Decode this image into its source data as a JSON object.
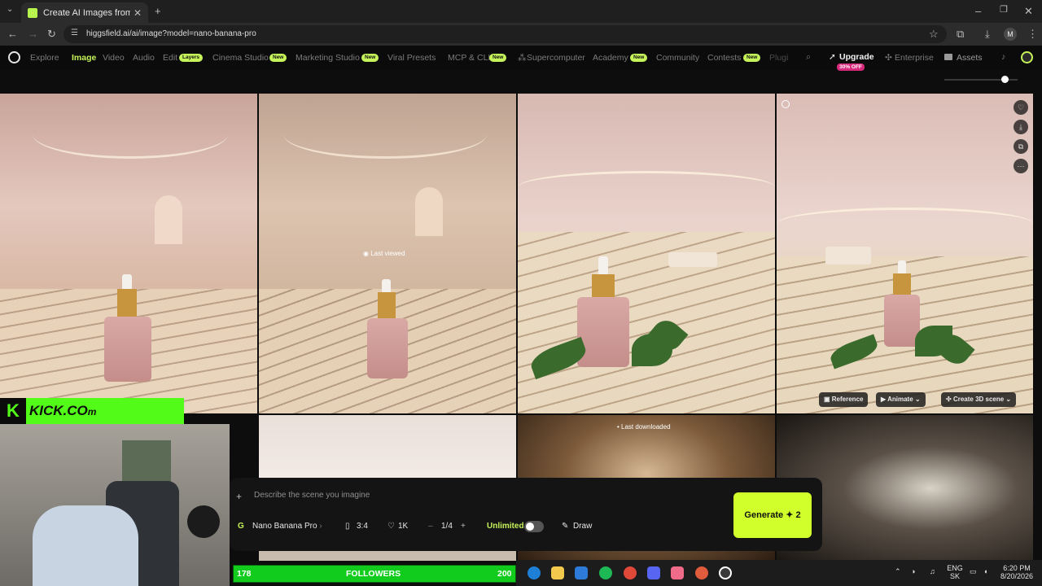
{
  "browser": {
    "tab_title": "Create AI Images from Text & P",
    "url": "higgsfield.ai/ai/image?model=nano-banana-pro",
    "profile_initial": "M"
  },
  "nav": {
    "items": [
      "Explore",
      "Image",
      "Video",
      "Audio",
      "Edit",
      "Cinema Studio",
      "Marketing Studio",
      "Viral Presets",
      "MCP & CLI",
      "Supercomputer",
      "Academy",
      "Community",
      "Contests",
      "Plugi"
    ],
    "active": "Image",
    "badges": {
      "edit": "Layers",
      "cinema": "New",
      "marketing": "New",
      "mcp": "New",
      "academy": "New",
      "contests": "New"
    },
    "upgrade": "Upgrade",
    "upgrade_badge": "30% OFF",
    "enterprise": "Enterprise",
    "assets": "Assets"
  },
  "gallery": {
    "last_viewed": "Last viewed",
    "last_downloaded": "Last downloaded",
    "actions": {
      "reference": "Reference",
      "animate": "Animate",
      "create_3d": "Create 3D scene"
    }
  },
  "prompt": {
    "placeholder": "Describe the scene you imagine",
    "model": "Nano Banana Pro",
    "aspect": "3:4",
    "resolution": "1K",
    "count": "1/4",
    "unlimited": "Unlimited",
    "draw": "Draw",
    "generate": "Generate",
    "generate_cost": "✦ 2"
  },
  "stream": {
    "kick_text": "KICK.CO",
    "followers_count": "178",
    "followers_label": "FOLLOWERS",
    "followers_goal": "200"
  },
  "taskbar": {
    "lang": "ENG",
    "region": "SK",
    "time": "6:20 PM",
    "date": "8/20/2026"
  },
  "colors": {
    "accent": "#c6f35a",
    "generate": "#d1ff2b",
    "kick": "#53fc18",
    "badge_off": "#d6297c"
  }
}
